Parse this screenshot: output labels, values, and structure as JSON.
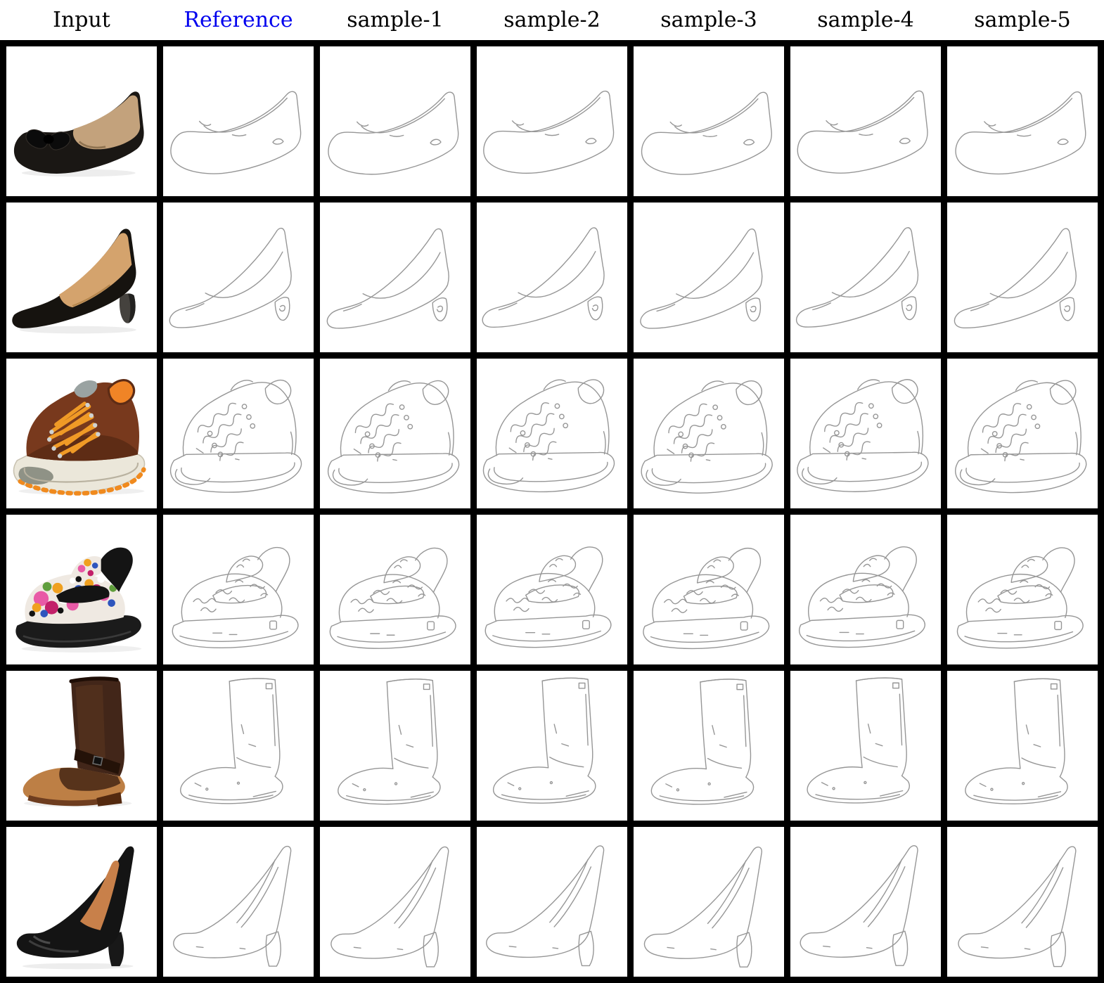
{
  "figure": {
    "description": "Comparison grid: input shoe photos vs reference edge sketch and five sampled sketches",
    "columns": [
      {
        "id": "input",
        "label": "Input",
        "label_color": "#000000",
        "type": "photo"
      },
      {
        "id": "reference",
        "label": "Reference",
        "label_color": "#0000ee",
        "type": "sketch"
      },
      {
        "id": "sample-1",
        "label": "sample-1",
        "label_color": "#000000",
        "type": "sketch"
      },
      {
        "id": "sample-2",
        "label": "sample-2",
        "label_color": "#000000",
        "type": "sketch"
      },
      {
        "id": "sample-3",
        "label": "sample-3",
        "label_color": "#000000",
        "type": "sketch"
      },
      {
        "id": "sample-4",
        "label": "sample-4",
        "label_color": "#000000",
        "type": "sketch"
      },
      {
        "id": "sample-5",
        "label": "sample-5",
        "label_color": "#000000",
        "type": "sketch"
      }
    ],
    "sketch_stroke": "#969696",
    "grid_line_color": "#000000",
    "rows": [
      {
        "id": "ballet-flat",
        "shoe": "flat",
        "input_alt": "Photo: black suede ballet flat with bow",
        "sketch_alt": "Line sketch of ballet flat",
        "colors": {
          "body": "#1a1714",
          "insole": "#c3a27c",
          "accent": "#0b0b0b"
        }
      },
      {
        "id": "kitten-heel-pump",
        "shoe": "pump",
        "input_alt": "Photo: black suede kitten-heel pump",
        "sketch_alt": "Line sketch of kitten-heel pump",
        "colors": {
          "body": "#16130f",
          "insole": "#d4a36d",
          "heel": "#45423e"
        }
      },
      {
        "id": "brown-lace-up-sneaker",
        "shoe": "sneaker",
        "input_alt": "Photo: brown leather sneaker with orange laces and cream sole",
        "sketch_alt": "Line sketch of lace-up sneaker",
        "colors": {
          "upper": "#78391d",
          "upper_shade": "#5e2c15",
          "sole": "#ebe7da",
          "laces": "#f09a26",
          "lugs": "#f08a1e",
          "toecap": "#8f9286",
          "collar": "#f08426",
          "tongue": "#9aa3a2",
          "eyelets": "#cfd2d2"
        }
      },
      {
        "id": "floral-mary-jane-clog",
        "shoe": "clog",
        "input_alt": "Photo: multicolor floral mary-jane clog with black platform sole",
        "sketch_alt": "Line sketch of mary-jane clog",
        "colors": {
          "sole": "#1b1b1b",
          "base": "#efe9e2",
          "dark": "#141414",
          "palette": [
            "#e85aa6",
            "#c22069",
            "#f0a01f",
            "#2e55bd",
            "#5f9e3c",
            "#ffffff",
            "#121212"
          ]
        }
      },
      {
        "id": "brown-harness-boot",
        "shoe": "boot",
        "input_alt": "Photo: two-tone brown leather harness boot",
        "sketch_alt": "Line sketch of tall boot",
        "colors": {
          "shaft": "#422619",
          "shaft_hi": "#5d3820",
          "foot": "#bd7f45",
          "vamp": "#4e2c18",
          "strap": "#241208",
          "sole": "#6e3d1f"
        }
      },
      {
        "id": "black-high-heel-pump",
        "shoe": "heel",
        "input_alt": "Photo: black high-heel platform pump",
        "sketch_alt": "Line sketch of high-heel pump",
        "colors": {
          "body": "#141414",
          "insole": "#c8804a",
          "heel": "#181818"
        }
      }
    ]
  }
}
